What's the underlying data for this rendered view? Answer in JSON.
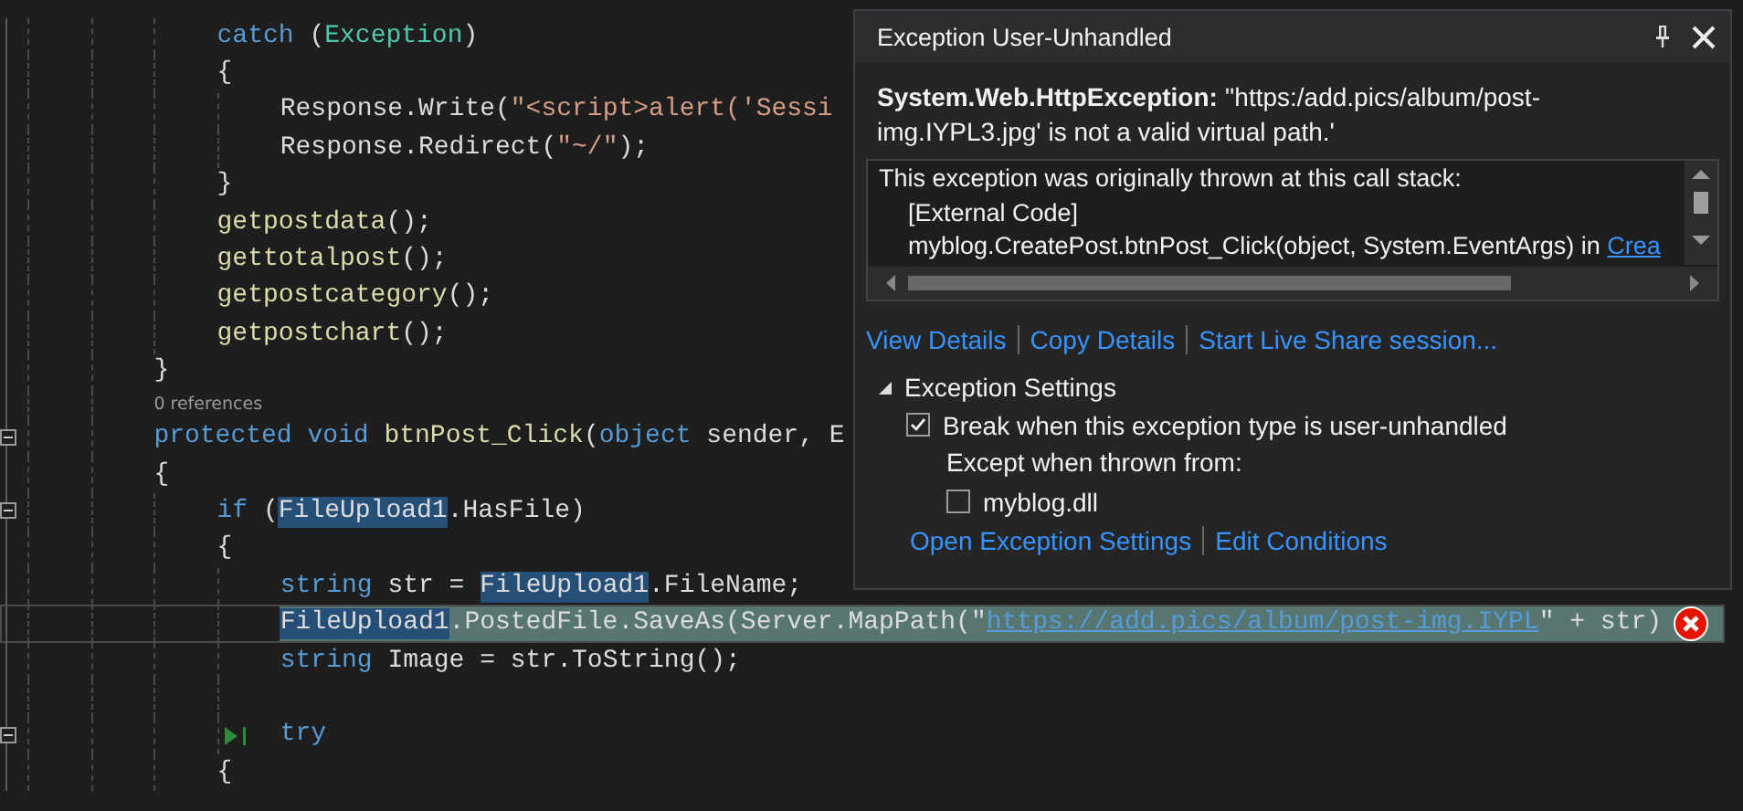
{
  "editor": {
    "lines": [
      {
        "kind": "block",
        "children": [
          {
            "kind": "code",
            "collapsible": false,
            "current": false,
            "run_to_click": false,
            "segments": [
              {
                "text": "catch",
                "kind": "keyword"
              },
              {
                "text": " (",
                "kind": "plain"
              },
              {
                "text": "Exception",
                "kind": "type"
              },
              {
                "text": ")",
                "kind": "plain"
              }
            ]
          },
          {
            "kind": "code",
            "collapsible": false,
            "current": false,
            "run_to_click": false,
            "segments": [
              {
                "text": "{",
                "kind": "plain"
              }
            ],
            "children": [
              {
                "kind": "code",
                "collapsible": false,
                "current": false,
                "run_to_click": false,
                "segments": [
                  {
                    "text": "Response.Write(",
                    "kind": "plain"
                  },
                  {
                    "text": "\"<script>alert('Sessi",
                    "kind": "string"
                  }
                ]
              },
              {
                "kind": "code",
                "collapsible": false,
                "current": false,
                "run_to_click": false,
                "segments": [
                  {
                    "text": "Response.Redirect(",
                    "kind": "plain"
                  },
                  {
                    "text": "\"~/\"",
                    "kind": "string"
                  },
                  {
                    "text": ");",
                    "kind": "plain"
                  }
                ]
              }
            ]
          },
          {
            "kind": "code",
            "collapsible": false,
            "current": false,
            "run_to_click": false,
            "segments": [
              {
                "text": "}",
                "kind": "plain"
              }
            ]
          },
          {
            "kind": "code",
            "collapsible": false,
            "current": false,
            "run_to_click": false,
            "segments": [
              {
                "text": "getpostdata",
                "kind": "method"
              },
              {
                "text": "();",
                "kind": "plain"
              }
            ]
          },
          {
            "kind": "code",
            "collapsible": false,
            "current": false,
            "run_to_click": false,
            "segments": [
              {
                "text": "gettotalpost",
                "kind": "method"
              },
              {
                "text": "();",
                "kind": "plain"
              }
            ]
          },
          {
            "kind": "code",
            "collapsible": false,
            "current": false,
            "run_to_click": false,
            "segments": [
              {
                "text": "getpostcategory",
                "kind": "method"
              },
              {
                "text": "();",
                "kind": "plain"
              }
            ]
          },
          {
            "kind": "code",
            "collapsible": false,
            "current": false,
            "run_to_click": false,
            "segments": [
              {
                "text": "getpostchart",
                "kind": "method"
              },
              {
                "text": "();",
                "kind": "plain"
              }
            ]
          }
        ]
      },
      {
        "kind": "code",
        "collapsible": false,
        "current": false,
        "run_to_click": false,
        "segments": [
          {
            "text": "}",
            "kind": "plain"
          }
        ]
      },
      {
        "kind": "codelens",
        "collapsible": false,
        "current": false,
        "run_to_click": false,
        "text": "0 references"
      },
      {
        "kind": "code",
        "collapsible": true,
        "current": false,
        "run_to_click": false,
        "segments": [
          {
            "text": "protected void",
            "kind": "keyword"
          },
          {
            "text": " btnPost_Click",
            "kind": "method"
          },
          {
            "text": "(",
            "kind": "plain"
          },
          {
            "text": "object",
            "kind": "keyword"
          },
          {
            "text": " sender, E",
            "kind": "plain"
          }
        ]
      },
      {
        "kind": "code",
        "collapsible": false,
        "current": false,
        "run_to_click": false,
        "segments": [
          {
            "text": "{",
            "kind": "plain"
          }
        ],
        "children": [
          {
            "kind": "code",
            "collapsible": true,
            "current": false,
            "run_to_click": false,
            "segments": [
              {
                "text": "if",
                "kind": "keyword"
              },
              {
                "text": " (",
                "kind": "plain"
              },
              {
                "text": "FileUpload1",
                "kind": "ref"
              },
              {
                "text": ".HasFile)",
                "kind": "plain"
              }
            ]
          },
          {
            "kind": "code",
            "collapsible": false,
            "current": false,
            "run_to_click": false,
            "segments": [
              {
                "text": "{",
                "kind": "plain"
              }
            ],
            "children": [
              {
                "kind": "code",
                "collapsible": false,
                "current": false,
                "run_to_click": false,
                "segments": [
                  {
                    "text": "string",
                    "kind": "keyword"
                  },
                  {
                    "text": " str = ",
                    "kind": "plain"
                  },
                  {
                    "text": "FileUpload1",
                    "kind": "ref"
                  },
                  {
                    "text": ".FileName;",
                    "kind": "plain"
                  }
                ]
              },
              {
                "kind": "code",
                "collapsible": false,
                "current": true,
                "run_to_click": false,
                "segments": [
                  {
                    "text": "FileUpload1",
                    "kind": "ref"
                  },
                  {
                    "text": ".PostedFile.SaveAs(Server.MapPath(\"",
                    "kind": "plain"
                  },
                  {
                    "text": "https://add.pics/album/post-img.IYPL",
                    "kind": "url"
                  },
                  {
                    "text": "\" + str)",
                    "kind": "plain"
                  }
                ]
              },
              {
                "kind": "code",
                "collapsible": false,
                "current": false,
                "run_to_click": false,
                "segments": [
                  {
                    "text": "string",
                    "kind": "keyword"
                  },
                  {
                    "text": " Image = str.ToString();",
                    "kind": "plain"
                  }
                ]
              },
              {
                "kind": "blank",
                "collapsible": false,
                "current": false,
                "run_to_click": false
              },
              {
                "kind": "code",
                "collapsible": true,
                "current": false,
                "run_to_click": true,
                "segments": [
                  {
                    "text": "try",
                    "kind": "keyword"
                  }
                ]
              }
            ]
          },
          {
            "kind": "code",
            "collapsible": false,
            "current": false,
            "run_to_click": false,
            "segments": [
              {
                "text": "{",
                "kind": "plain"
              }
            ]
          }
        ]
      }
    ]
  },
  "exception_popup": {
    "title": "Exception User-Unhandled",
    "message": "**System.Web.HttpException:** ''https:/add.pics/album/post-img.IYPL3.jpg' is not a valid virtual path.'",
    "call_stack": {
      "heading": "This exception was originally thrown at this call stack:",
      "frames": [
        {
          "text": "[External Code]"
        },
        {
          "text": "myblog.CreatePost.btnPost_Click(object, System.EventArgs) in ",
          "link": "Crea"
        }
      ]
    },
    "links": [
      "View Details",
      "Copy Details",
      "Start Live Share session..."
    ],
    "settings": {
      "label": "Exception Settings",
      "expanded": true,
      "break_option": {
        "label": "Break when this exception type is user-unhandled",
        "checked": true
      },
      "except_label": "Except when thrown from:",
      "modules": [
        {
          "label": "myblog.dll",
          "checked": false
        }
      ],
      "links": [
        "Open Exception Settings",
        "Edit Conditions"
      ]
    }
  }
}
